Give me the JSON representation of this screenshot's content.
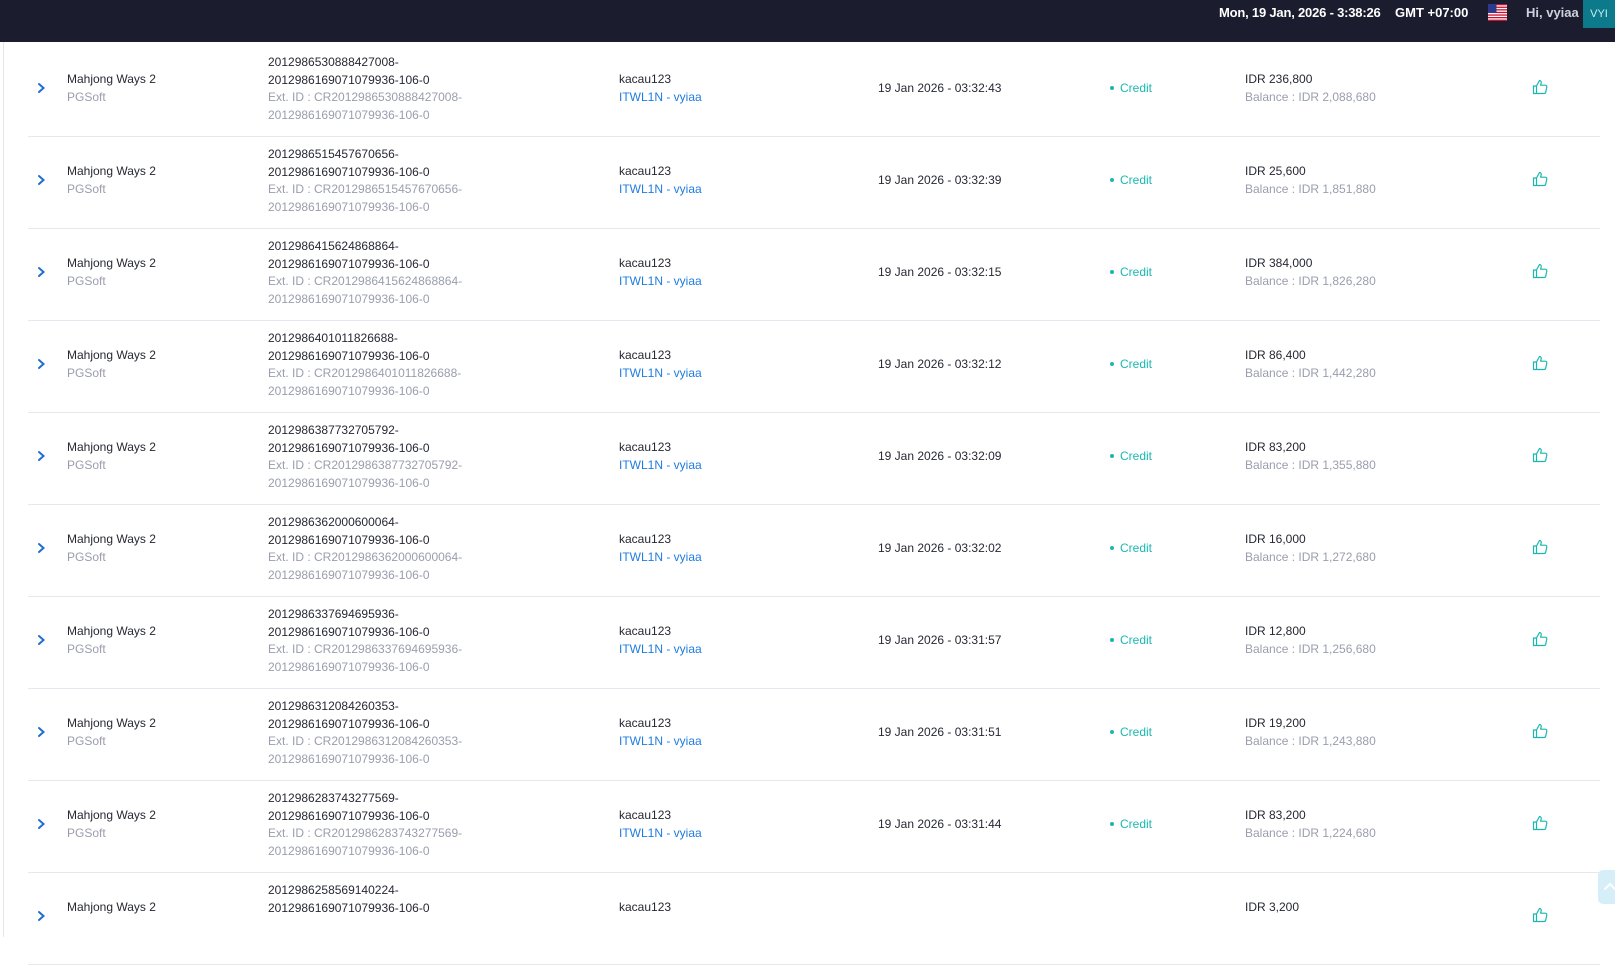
{
  "header": {
    "datetime": "Mon, 19 Jan, 2026 - 3:38:26",
    "timezone": "GMT +07:00",
    "greeting": "Hi, vyiaa",
    "avatar": "VYI",
    "flag_icon": "us-flag-icon"
  },
  "colors": {
    "header_bg": "#1b1d2e",
    "credit": "#18b8b0",
    "agent_link": "#1f7de0",
    "muted": "#9a9dad"
  },
  "transactions": [
    {
      "game": "Mahjong Ways 2",
      "provider": "PGSoft",
      "txn_line1": "2012986530888427008-",
      "txn_line2": "2012986169071079936-106-0",
      "ext_line1": "Ext. ID : CR2012986530888427008-",
      "ext_line2": "2012986169071079936-106-0",
      "player": "kacau123",
      "agent": "ITWL1N - vyiaa",
      "time": "19 Jan 2026 - 03:32:43",
      "type": "Credit",
      "amount": "IDR 236,800",
      "balance": "Balance : IDR 2,088,680"
    },
    {
      "game": "Mahjong Ways 2",
      "provider": "PGSoft",
      "txn_line1": "2012986515457670656-",
      "txn_line2": "2012986169071079936-106-0",
      "ext_line1": "Ext. ID : CR2012986515457670656-",
      "ext_line2": "2012986169071079936-106-0",
      "player": "kacau123",
      "agent": "ITWL1N - vyiaa",
      "time": "19 Jan 2026 - 03:32:39",
      "type": "Credit",
      "amount": "IDR 25,600",
      "balance": "Balance : IDR 1,851,880"
    },
    {
      "game": "Mahjong Ways 2",
      "provider": "PGSoft",
      "txn_line1": "2012986415624868864-",
      "txn_line2": "2012986169071079936-106-0",
      "ext_line1": "Ext. ID : CR2012986415624868864-",
      "ext_line2": "2012986169071079936-106-0",
      "player": "kacau123",
      "agent": "ITWL1N - vyiaa",
      "time": "19 Jan 2026 - 03:32:15",
      "type": "Credit",
      "amount": "IDR 384,000",
      "balance": "Balance : IDR 1,826,280"
    },
    {
      "game": "Mahjong Ways 2",
      "provider": "PGSoft",
      "txn_line1": "2012986401011826688-",
      "txn_line2": "2012986169071079936-106-0",
      "ext_line1": "Ext. ID : CR2012986401011826688-",
      "ext_line2": "2012986169071079936-106-0",
      "player": "kacau123",
      "agent": "ITWL1N - vyiaa",
      "time": "19 Jan 2026 - 03:32:12",
      "type": "Credit",
      "amount": "IDR 86,400",
      "balance": "Balance : IDR 1,442,280"
    },
    {
      "game": "Mahjong Ways 2",
      "provider": "PGSoft",
      "txn_line1": "2012986387732705792-",
      "txn_line2": "2012986169071079936-106-0",
      "ext_line1": "Ext. ID : CR2012986387732705792-",
      "ext_line2": "2012986169071079936-106-0",
      "player": "kacau123",
      "agent": "ITWL1N - vyiaa",
      "time": "19 Jan 2026 - 03:32:09",
      "type": "Credit",
      "amount": "IDR 83,200",
      "balance": "Balance : IDR 1,355,880"
    },
    {
      "game": "Mahjong Ways 2",
      "provider": "PGSoft",
      "txn_line1": "2012986362000600064-",
      "txn_line2": "2012986169071079936-106-0",
      "ext_line1": "Ext. ID : CR2012986362000600064-",
      "ext_line2": "2012986169071079936-106-0",
      "player": "kacau123",
      "agent": "ITWL1N - vyiaa",
      "time": "19 Jan 2026 - 03:32:02",
      "type": "Credit",
      "amount": "IDR 16,000",
      "balance": "Balance : IDR 1,272,680"
    },
    {
      "game": "Mahjong Ways 2",
      "provider": "PGSoft",
      "txn_line1": "2012986337694695936-",
      "txn_line2": "2012986169071079936-106-0",
      "ext_line1": "Ext. ID : CR2012986337694695936-",
      "ext_line2": "2012986169071079936-106-0",
      "player": "kacau123",
      "agent": "ITWL1N - vyiaa",
      "time": "19 Jan 2026 - 03:31:57",
      "type": "Credit",
      "amount": "IDR 12,800",
      "balance": "Balance : IDR 1,256,680"
    },
    {
      "game": "Mahjong Ways 2",
      "provider": "PGSoft",
      "txn_line1": "2012986312084260353-",
      "txn_line2": "2012986169071079936-106-0",
      "ext_line1": "Ext. ID : CR2012986312084260353-",
      "ext_line2": "2012986169071079936-106-0",
      "player": "kacau123",
      "agent": "ITWL1N - vyiaa",
      "time": "19 Jan 2026 - 03:31:51",
      "type": "Credit",
      "amount": "IDR 19,200",
      "balance": "Balance : IDR 1,243,880"
    },
    {
      "game": "Mahjong Ways 2",
      "provider": "PGSoft",
      "txn_line1": "2012986283743277569-",
      "txn_line2": "2012986169071079936-106-0",
      "ext_line1": "Ext. ID : CR2012986283743277569-",
      "ext_line2": "2012986169071079936-106-0",
      "player": "kacau123",
      "agent": "ITWL1N - vyiaa",
      "time": "19 Jan 2026 - 03:31:44",
      "type": "Credit",
      "amount": "IDR 83,200",
      "balance": "Balance : IDR 1,224,680"
    },
    {
      "game": "Mahjong Ways 2",
      "provider": "",
      "txn_line1": "2012986258569140224-",
      "txn_line2": "2012986169071079936-106-0",
      "ext_line1": "",
      "ext_line2": "",
      "player": "kacau123",
      "agent": "",
      "time": "",
      "type": "",
      "amount": "IDR 3,200",
      "balance": ""
    }
  ]
}
